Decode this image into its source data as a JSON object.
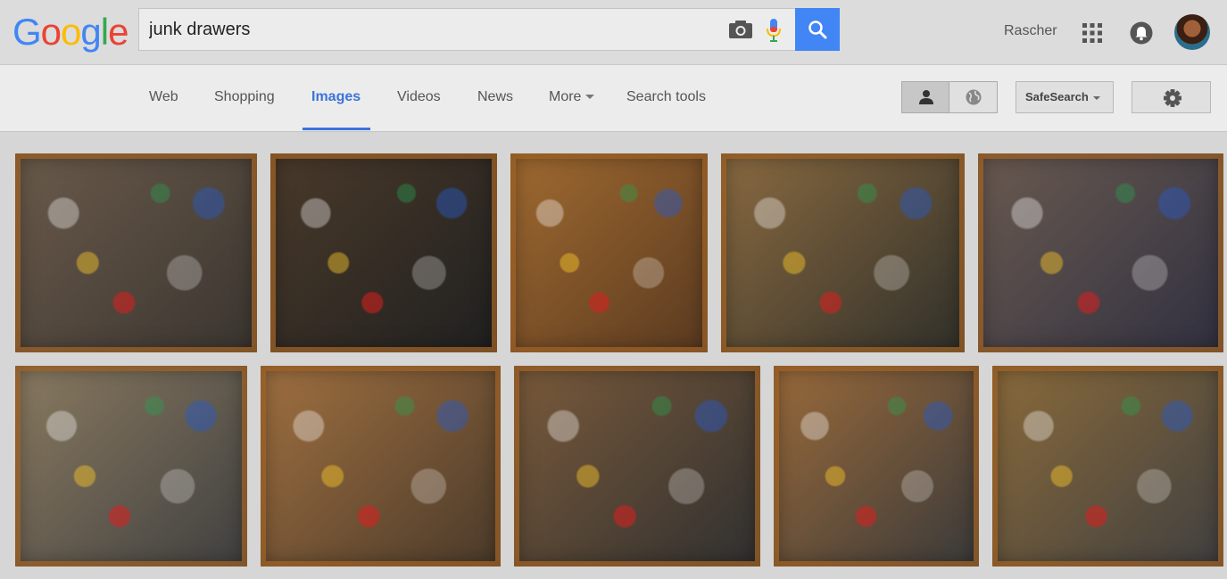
{
  "header": {
    "logo_letters": [
      "G",
      "o",
      "o",
      "g",
      "l",
      "e"
    ],
    "search_value": "junk drawers",
    "user_name": "Rascher"
  },
  "nav": {
    "tabs": [
      "Web",
      "Shopping",
      "Images",
      "Videos",
      "News",
      "More",
      "Search tools"
    ],
    "active_tab": "Images",
    "safesearch_label": "SafeSearch"
  },
  "colors": {
    "accent": "#3b73d8",
    "search_button": "#4285f4",
    "logo": [
      "#4285f4",
      "#ea4335",
      "#fbbc05",
      "#4285f4",
      "#34a853",
      "#ea4335"
    ]
  },
  "results": {
    "rows": [
      [
        {
          "name": "result-image-1",
          "desc": "junk drawer",
          "colors": [
            "#6a5a4a",
            "#3a3530"
          ]
        },
        {
          "name": "result-image-2",
          "desc": "junk drawer",
          "colors": [
            "#4a3a2a",
            "#202020"
          ]
        },
        {
          "name": "result-image-3",
          "desc": "junk drawer",
          "colors": [
            "#a06a30",
            "#5a3a20"
          ]
        },
        {
          "name": "result-image-4",
          "desc": "junk drawer",
          "colors": [
            "#8a6a40",
            "#30302a"
          ]
        },
        {
          "name": "result-image-5",
          "desc": "junk drawer",
          "colors": [
            "#6a5a50",
            "#303040"
          ]
        }
      ],
      [
        {
          "name": "result-image-6",
          "desc": "junk drawer",
          "colors": [
            "#8a7a60",
            "#404040"
          ]
        },
        {
          "name": "result-image-7",
          "desc": "junk drawer",
          "colors": [
            "#a07040",
            "#4a3a2a"
          ]
        },
        {
          "name": "result-image-8",
          "desc": "junk drawer",
          "colors": [
            "#7a5a3a",
            "#303030"
          ]
        },
        {
          "name": "result-image-9",
          "desc": "junk drawer",
          "colors": [
            "#9a6a3a",
            "#3a3a3a"
          ]
        },
        {
          "name": "result-image-10",
          "desc": "junk drawer",
          "colors": [
            "#8a6a3a",
            "#404040"
          ]
        }
      ]
    ]
  }
}
